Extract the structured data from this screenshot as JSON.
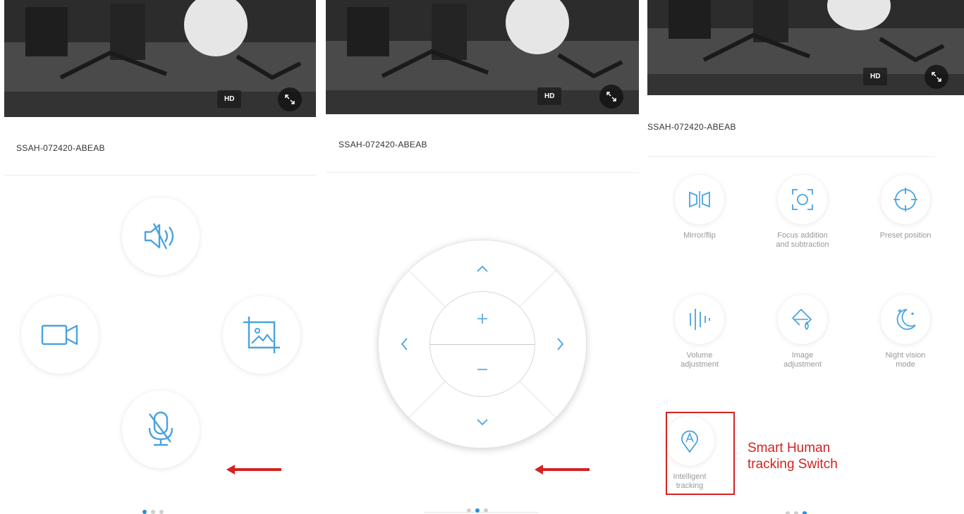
{
  "device_name": "SSAH-072420-ABEAB",
  "video": {
    "quality_badge": "HD"
  },
  "panel3": {
    "grid": [
      {
        "label": "Mirror/flip",
        "icon": "mirror-flip-icon"
      },
      {
        "label": "Focus addition\nand subtraction",
        "icon": "focus-icon"
      },
      {
        "label": "Preset position",
        "icon": "preset-position-icon"
      },
      {
        "label": "Volume\nadjustment",
        "icon": "volume-adjust-icon"
      },
      {
        "label": "Image\nadjustment",
        "icon": "image-adjust-icon"
      },
      {
        "label": "Night vision\nmode",
        "icon": "night-vision-icon"
      },
      {
        "label": "Intelligent\ntracking",
        "icon": "intelligent-tracking-icon"
      }
    ],
    "annotation": "Smart Human\ntracking Switch"
  },
  "colors": {
    "accent": "#4aa3df",
    "annotation_red": "#d42222",
    "page_dot_active": "#2a8fd8"
  },
  "pagination": {
    "panel1_active": 1,
    "panel2_active": 2,
    "panel3_active": 3
  }
}
